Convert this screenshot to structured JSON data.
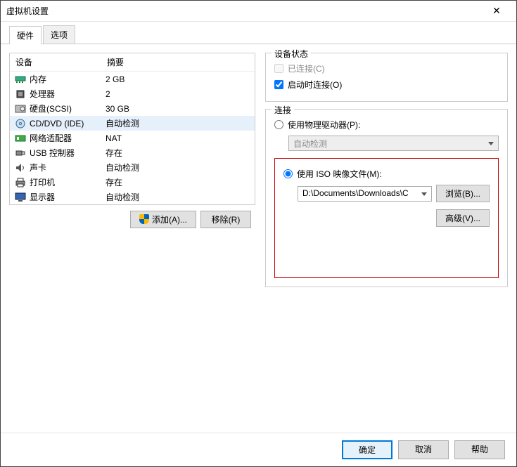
{
  "window": {
    "title": "虚拟机设置",
    "close": "✕"
  },
  "tabs": {
    "hardware": "硬件",
    "options": "选项"
  },
  "hw_header": {
    "device": "设备",
    "summary": "摘要"
  },
  "hw": [
    {
      "icon": "memory",
      "name": "内存",
      "summary": "2 GB"
    },
    {
      "icon": "cpu",
      "name": "处理器",
      "summary": "2"
    },
    {
      "icon": "disk",
      "name": "硬盘(SCSI)",
      "summary": "30 GB"
    },
    {
      "icon": "cd",
      "name": "CD/DVD (IDE)",
      "summary": "自动检测",
      "selected": true
    },
    {
      "icon": "net",
      "name": "网络适配器",
      "summary": "NAT"
    },
    {
      "icon": "usb",
      "name": "USB 控制器",
      "summary": "存在"
    },
    {
      "icon": "sound",
      "name": "声卡",
      "summary": "自动检测"
    },
    {
      "icon": "printer",
      "name": "打印机",
      "summary": "存在"
    },
    {
      "icon": "display",
      "name": "显示器",
      "summary": "自动检测"
    }
  ],
  "left_buttons": {
    "add": "添加(A)...",
    "remove": "移除(R)"
  },
  "status_group": {
    "title": "设备状态",
    "connected": "已连接(C)",
    "connect_on_start": "启动时连接(O)"
  },
  "conn_group": {
    "title": "连接",
    "use_physical": "使用物理驱动器(P):",
    "auto_detect": "自动检测",
    "use_iso": "使用 ISO 映像文件(M):",
    "iso_path": "D:\\Documents\\Downloads\\C",
    "browse": "浏览(B)...",
    "advanced": "高级(V)..."
  },
  "footer": {
    "ok": "确定",
    "cancel": "取消",
    "help": "帮助"
  }
}
